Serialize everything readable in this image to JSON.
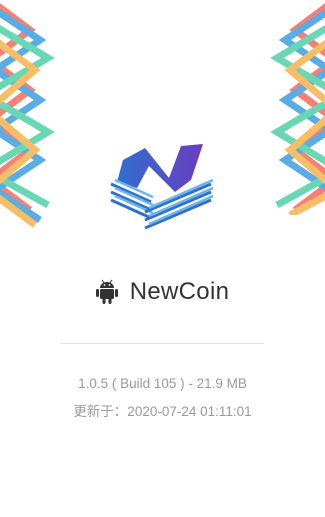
{
  "app": {
    "name": "NewCoin",
    "platform_icon": "android-icon",
    "logo_icon": "newcoin-logo-icon"
  },
  "build": {
    "version_line": "1.0.5 ( Build 105 ) - 21.9 MB",
    "updated_line": "更新于：2020-07-24 01:11:01"
  },
  "colors": {
    "stripe_red": "#f46b5b",
    "stripe_green": "#4fcfa8",
    "stripe_blue": "#3d9ee0",
    "stripe_orange": "#f7b34d",
    "logo_blue": "#2f6fd0",
    "logo_purple": "#6a3dbf",
    "text_primary": "#333333",
    "text_secondary": "#9a9a9a"
  }
}
